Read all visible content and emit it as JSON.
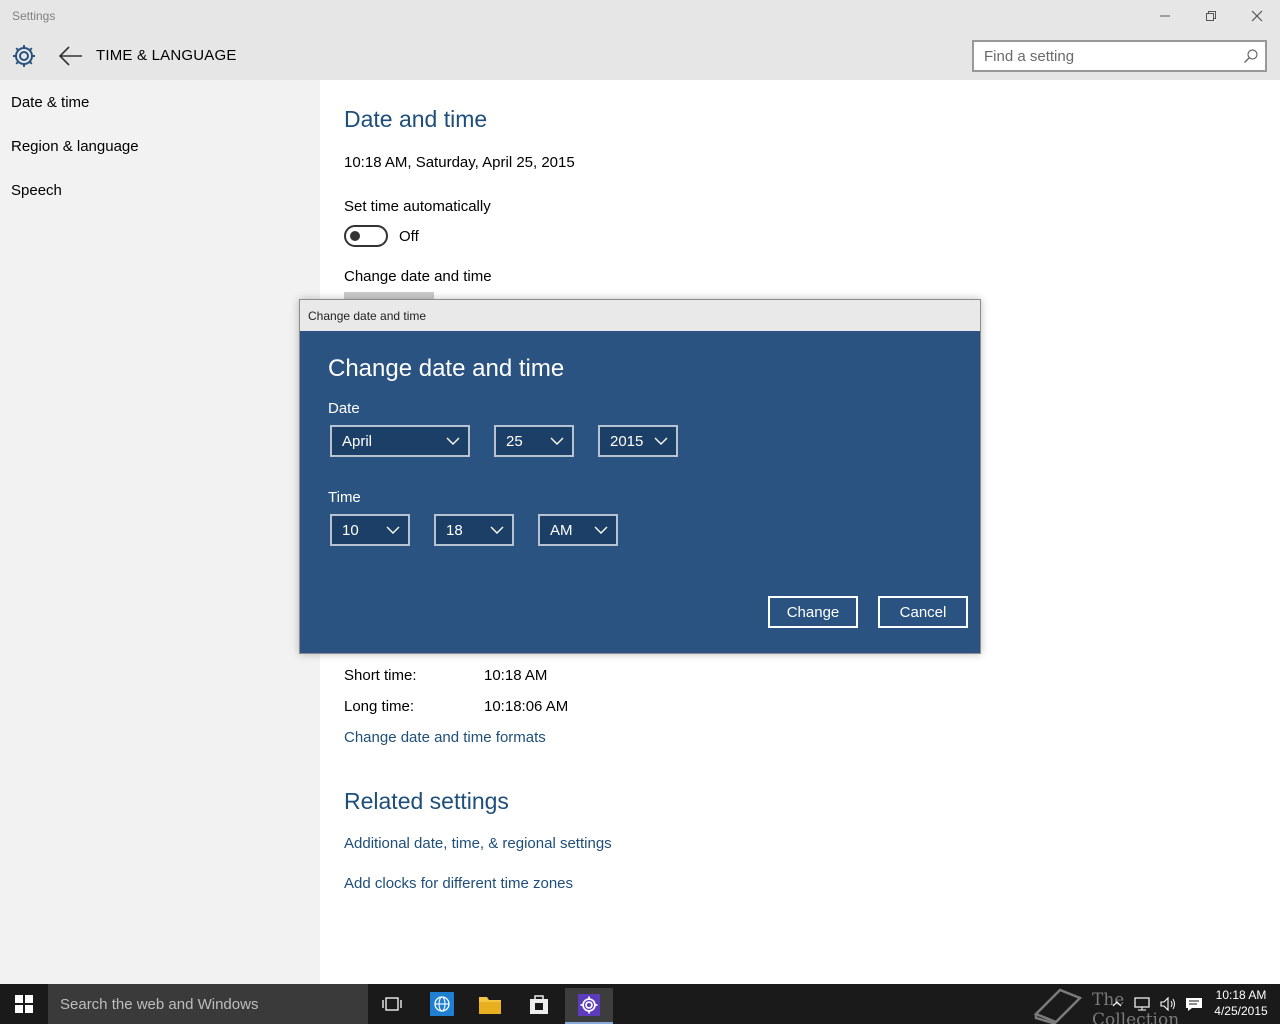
{
  "window": {
    "title": "Settings"
  },
  "header": {
    "title": "TIME & LANGUAGE",
    "search_placeholder": "Find a setting"
  },
  "sidebar": {
    "items": [
      {
        "label": "Date & time"
      },
      {
        "label": "Region & language"
      },
      {
        "label": "Speech"
      }
    ]
  },
  "main": {
    "heading": "Date and time",
    "current_datetime": "10:18 AM, Saturday, April 25, 2015",
    "set_time_auto_label": "Set time automatically",
    "toggle_state": "Off",
    "change_label": "Change date and time",
    "formats": [
      {
        "label": "Short time:",
        "value": "10:18 AM"
      },
      {
        "label": "Long time:",
        "value": "10:18:06 AM"
      }
    ],
    "change_formats_link": "Change date and time formats",
    "related_heading": "Related settings",
    "related_links": [
      "Additional date, time, & regional settings",
      "Add clocks for different time zones"
    ]
  },
  "dialog": {
    "window_title": "Change date and time",
    "heading": "Change date and time",
    "date_label": "Date",
    "month": "April",
    "day": "25",
    "year": "2015",
    "time_label": "Time",
    "hour": "10",
    "minute": "18",
    "ampm": "AM",
    "change_button": "Change",
    "cancel_button": "Cancel",
    "background_color": "#2b5382"
  },
  "taskbar": {
    "search_placeholder": "Search the web and Windows",
    "clock_time": "10:18 AM",
    "clock_date": "4/25/2015",
    "watermark": "The Collection Book"
  },
  "colors": {
    "accent": "#1e4e79",
    "sidebar": "#f2f2f2",
    "taskbar": "#1a1a1a"
  }
}
